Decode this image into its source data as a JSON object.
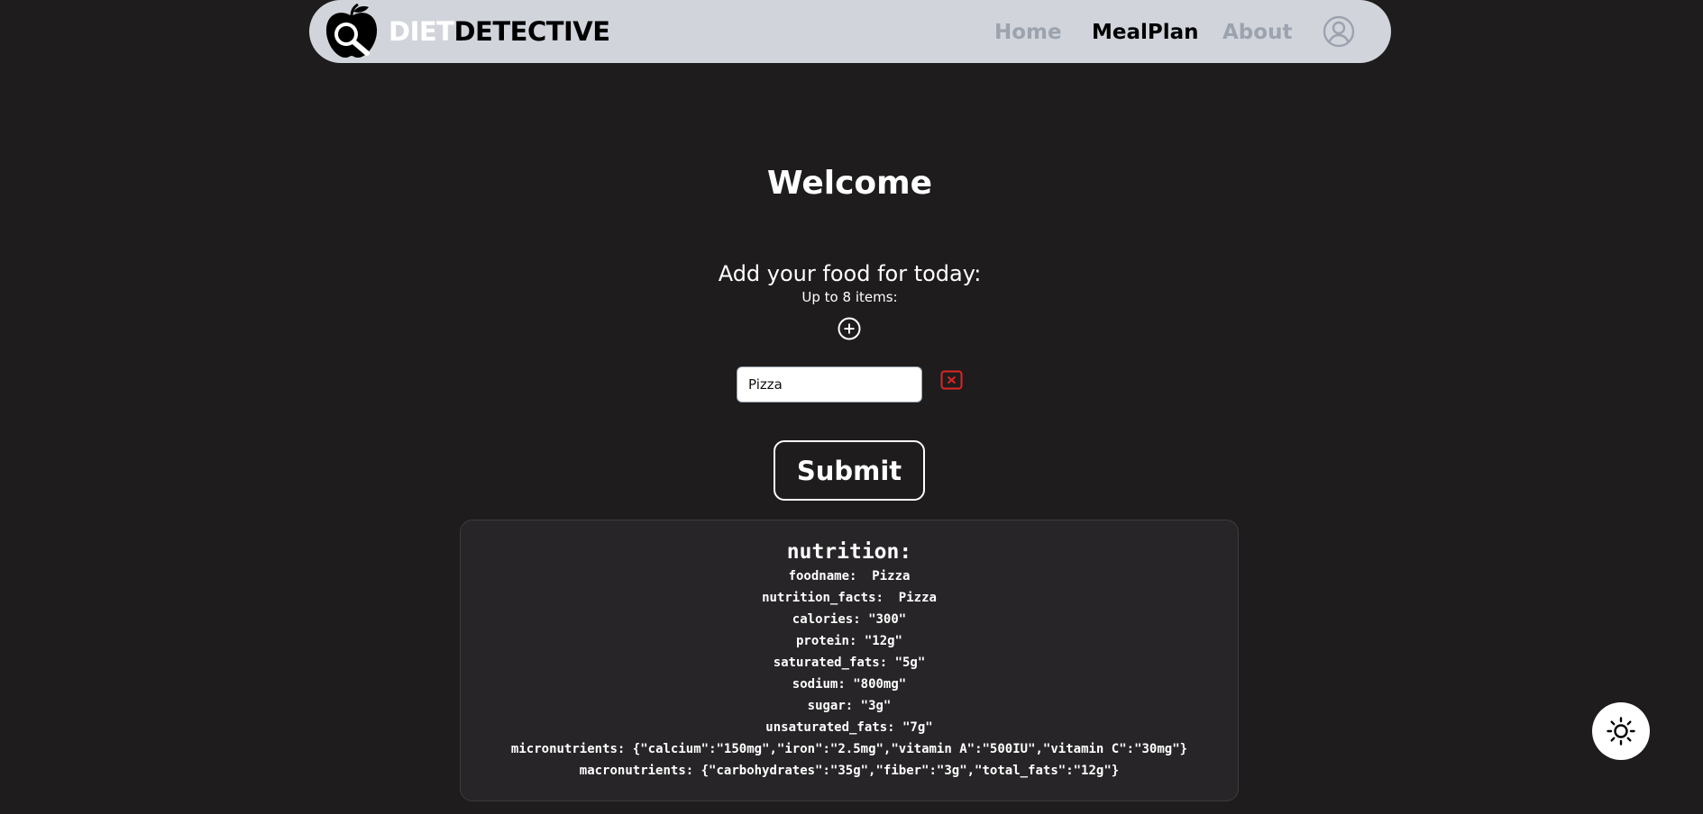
{
  "header": {
    "brand_part1": "DIET",
    "brand_part2": "DETECTIVE",
    "nav": {
      "home": "Home",
      "mealplan": "MealPlan",
      "about": "About"
    },
    "icons": {
      "logo": "apple-magnifier-logo",
      "profile": "user-circle-icon"
    }
  },
  "main": {
    "welcome": "Welcome",
    "add_food_heading": "Add your food for today:",
    "limit_text": "Up to 8 items:",
    "add_icon": "plus-circle-icon",
    "food_input_value": "Pizza",
    "remove_icon": "close-box-icon",
    "submit_label": "Submit"
  },
  "nutrition": {
    "title": "nutrition:",
    "lines": [
      "foodname:  Pizza",
      "nutrition_facts:  Pizza",
      "calories: \"300\"",
      "protein: \"12g\"",
      "saturated_fats: \"5g\"",
      "sodium: \"800mg\"",
      "sugar: \"3g\"",
      "unsaturated_fats: \"7g\"",
      "micronutrients: {\"calcium\":\"150mg\",\"iron\":\"2.5mg\",\"vitamin A\":\"500IU\",\"vitamin C\":\"30mg\"}",
      "macronutrients: {\"carbohydrates\":\"35g\",\"fiber\":\"3g\",\"total_fats\":\"12g\"}"
    ]
  },
  "theme_toggle_icon": "sun-icon",
  "colors": {
    "background": "#1e1c1d",
    "navbar": "#d1d5db",
    "nav_inactive": "#9ca3af",
    "remove_red": "#dc2626",
    "panel": "#272527"
  }
}
